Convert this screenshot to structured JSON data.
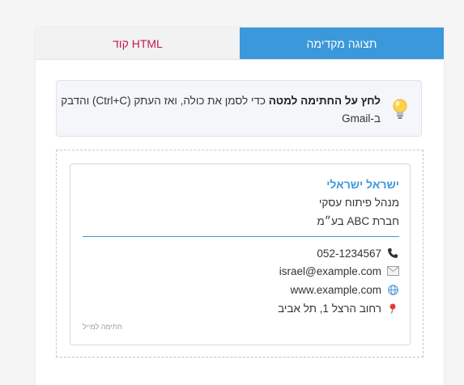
{
  "tabs": {
    "code_label": "קוד HTML",
    "preview_label": "תצוגה מקדימה"
  },
  "tip": {
    "bold_text": "לחץ על החתימה למטה",
    "text": " כדי לסמן את כולה, ואז העתק (Ctrl+C) והדבק ב-Gmail",
    "icon": "lightbulb-icon"
  },
  "signature": {
    "name": "ישראל ישראלי",
    "role": "מנהל פיתוח עסקי",
    "company": "חברת ABC בע״מ",
    "phone": "052-1234567",
    "email": "israel@example.com",
    "website": "www.example.com",
    "address": "רחוב הרצל 1, תל אביב",
    "footer_note": "חתימה למייל"
  },
  "colors": {
    "accent": "#3b98da",
    "code_tab_text": "#c2185b"
  }
}
